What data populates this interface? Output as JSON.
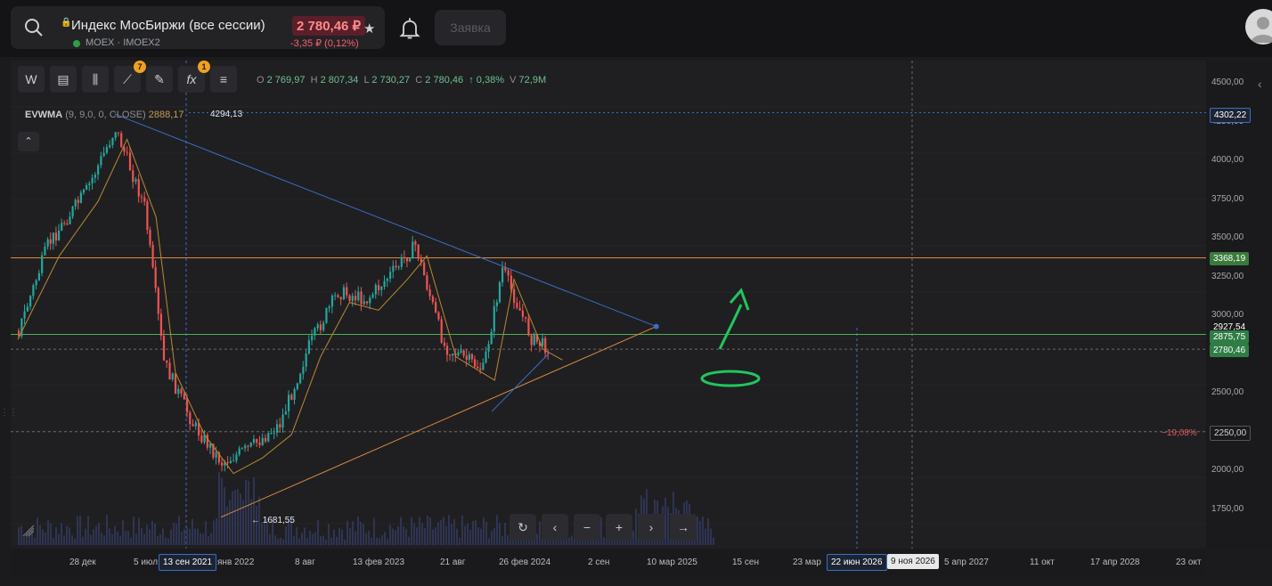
{
  "header": {
    "instrument_title": "Индекс МосБиржи (все сессии)",
    "exchange": "MOEX",
    "ticker": "IMOEX2",
    "price": "2 780,46 ₽",
    "change": "-3,35 ₽ (0,12%)",
    "order_button": "Заявка"
  },
  "toolbar": {
    "timeframe": "W",
    "drawings_badge": "7",
    "indicators_badge": "1",
    "fx_label": "fx"
  },
  "ohlc": {
    "o_label": "O",
    "o": "2 769,97",
    "h_label": "H",
    "h": "2 807,34",
    "l_label": "L",
    "l": "2 730,27",
    "c_label": "C",
    "c": "2 780,46",
    "change": "↑ 0,38%",
    "v_label": "V",
    "v": "72,9M"
  },
  "indicator": {
    "name": "EVWMA",
    "params": "(9, 9,0, 0, CLOSE)",
    "value": "2888,17"
  },
  "annotations": {
    "high_label": "4294,13",
    "low_label": "← 1681,55",
    "pct_label": "−19,08%"
  },
  "price_axis": {
    "labels": [
      "4500,00",
      "4250,00",
      "4000,00",
      "3750,00",
      "3500,00",
      "3250,00",
      "3000,00",
      "2500,00",
      "2000,00",
      "1750,00"
    ],
    "tags": {
      "high": "4302,22",
      "orange": "3368,19",
      "trend": "2927,54",
      "green": "2875,75",
      "current": "2780,46",
      "pct": "2250,00"
    }
  },
  "time_axis": {
    "labels": [
      "28 дек",
      "5 июл",
      "янв 2022",
      "8 авг",
      "13 фев 2023",
      "21 авг",
      "26 фев 2024",
      "2 сен",
      "10 мар 2025",
      "15 сен",
      "23 мар",
      "5 апр 2027",
      "11 окт",
      "17 апр 2028",
      "23 окт"
    ],
    "tag_start": "13 сен 2021",
    "tag_end": "22 июн 2026",
    "tag_cursor": "9 ноя 2026"
  },
  "colors": {
    "up": "#26a69a",
    "down": "#ef5350",
    "trend_blue": "#3d6cc4",
    "orange_level": "#d98a3a",
    "green_level": "#4caf50",
    "evwma": "#b98a2e",
    "hand_drawn": "#22c55e"
  },
  "chart_data": {
    "type": "candlestick",
    "interval": "W",
    "y_range": [
      1600,
      4550
    ],
    "key_points": [
      {
        "x": "2021-10",
        "y": 4294.13,
        "label": "high"
      },
      {
        "x": "2022-02",
        "y": 1681.55,
        "label": "low"
      }
    ],
    "close_path": [
      {
        "x": "2020-12",
        "y": 2900
      },
      {
        "x": "2021-03",
        "y": 3450
      },
      {
        "x": "2021-07",
        "y": 3800
      },
      {
        "x": "2021-10",
        "y": 4200
      },
      {
        "x": "2022-01",
        "y": 3700
      },
      {
        "x": "2022-03",
        "y": 2700
      },
      {
        "x": "2022-06",
        "y": 2300
      },
      {
        "x": "2022-09",
        "y": 2050
      },
      {
        "x": "2022-12",
        "y": 2150
      },
      {
        "x": "2023-03",
        "y": 2300
      },
      {
        "x": "2023-06",
        "y": 2800
      },
      {
        "x": "2023-09",
        "y": 3150
      },
      {
        "x": "2023-12",
        "y": 3100
      },
      {
        "x": "2024-03",
        "y": 3300
      },
      {
        "x": "2024-05",
        "y": 3450
      },
      {
        "x": "2024-08",
        "y": 2800
      },
      {
        "x": "2024-12",
        "y": 2650
      },
      {
        "x": "2025-02",
        "y": 3300
      },
      {
        "x": "2025-05",
        "y": 2850
      },
      {
        "x": "2025-07",
        "y": 2780
      }
    ],
    "levels": [
      {
        "name": "orange",
        "value": 3368.19
      },
      {
        "name": "green",
        "value": 2875.75
      },
      {
        "name": "current",
        "value": 2780.46
      },
      {
        "name": "alert",
        "value": 2250.0
      }
    ],
    "trendlines": [
      {
        "from": {
          "x": "2021-10",
          "y": 4294
        },
        "to": {
          "x": "2026-06",
          "y": 2927
        }
      },
      {
        "from": {
          "x": "2022-09",
          "y": 1700
        },
        "to": {
          "x": "2026-06",
          "y": 2927
        }
      },
      {
        "from": {
          "x": "2025-01",
          "y": 2380
        },
        "to": {
          "x": "2025-07",
          "y": 2760
        }
      }
    ]
  }
}
